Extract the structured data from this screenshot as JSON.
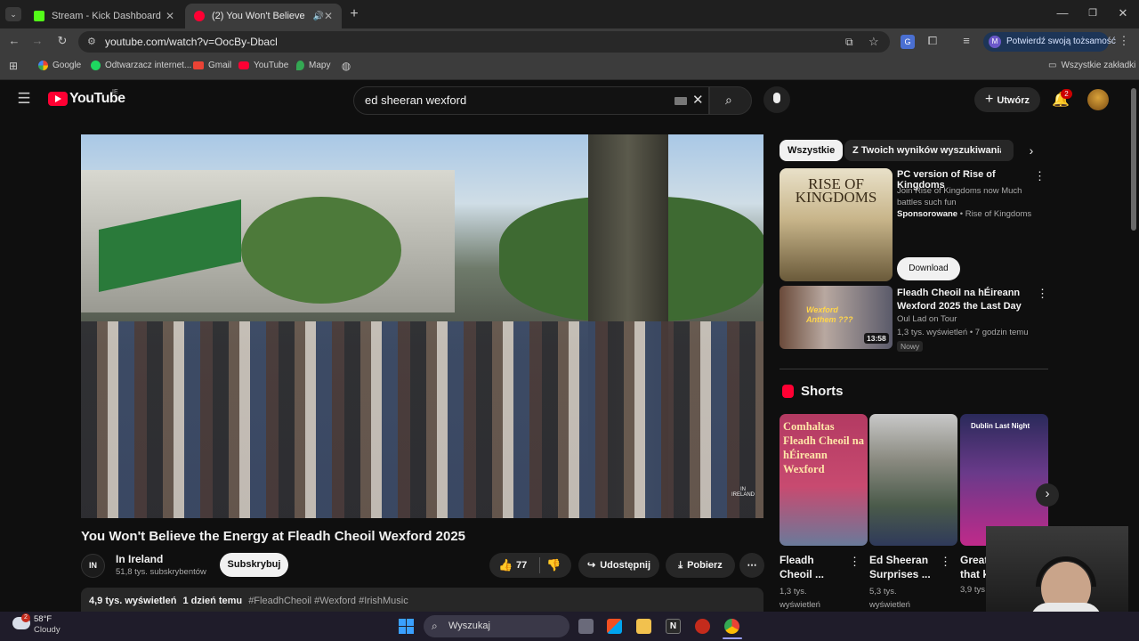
{
  "browser": {
    "tabs": [
      {
        "title": "Stream - Kick Dashboard"
      },
      {
        "title": "(2) You Won't Believe the E"
      }
    ],
    "url": "youtube.com/watch?v=OocBy-Dbacl",
    "profile_label": "Potwierdź swoją tożsamość",
    "bookmarks": [
      "Google",
      "Odtwarzacz internet...",
      "Gmail",
      "YouTube",
      "Mapy"
    ],
    "all_bookmarks": "Wszystkie zakładki"
  },
  "youtube": {
    "logo": "YouTube",
    "region": "IE",
    "search_value": "ed sheeran wexford",
    "create_label": "Utwórz",
    "notification_count": "2",
    "video": {
      "title": "You Won't Believe the Energy at Fleadh Cheoil Wexford 2025",
      "channel": "In Ireland",
      "subscribers": "51,8 tys. subskrybentów",
      "subscribe_label": "Subskrybuj",
      "likes": "77",
      "share_label": "Udostępnij",
      "download_label": "Pobierz",
      "views": "4,9 tys. wyświetleń",
      "age": "1 dzień temu",
      "hashtags": "#FleadhCheoil #Wexford #IrishMusic",
      "watermark": "IN IRELAND"
    },
    "chips": [
      "Wszystkie",
      "Z Twoich wyników wyszukiwania"
    ],
    "ad": {
      "title": "PC version of Rise of Kingdoms",
      "desc": "Join Rise of Kingdoms now Much battles such fun",
      "sponsored": "Sponsorowane",
      "advertiser": "Rise of Kingdoms",
      "cta": "Download",
      "thumb_text": "RISE OF KINGDOMS"
    },
    "related": {
      "title": "Fleadh Cheoil na hÉireann Wexford 2025 the Last Day",
      "channel": "Oul Lad on Tour",
      "meta": "1,3 tys. wyświetleń • 7 godzin temu",
      "badge": "Nowy",
      "duration": "13:58",
      "thumb_text": "Wexford Anthem ???"
    },
    "shorts_heading": "Shorts",
    "shorts": [
      {
        "title": "Fleadh Cheoil ...",
        "views": "1,3 tys. wyświetleń",
        "thumb_text": "Comhaltas Fleadh Cheoil na hÉireann Wexford"
      },
      {
        "title": "Ed Sheeran Surprises ...",
        "views": "5,3 tys. wyświetleń",
        "thumb_text": ""
      },
      {
        "title": "Great that k",
        "views": "3,9 tys",
        "thumb_text": "Dublin Last Night"
      }
    ]
  },
  "taskbar": {
    "temperature": "58°F",
    "weather": "Cloudy",
    "weather_badge": "2",
    "search_placeholder": "Wyszukaj"
  }
}
